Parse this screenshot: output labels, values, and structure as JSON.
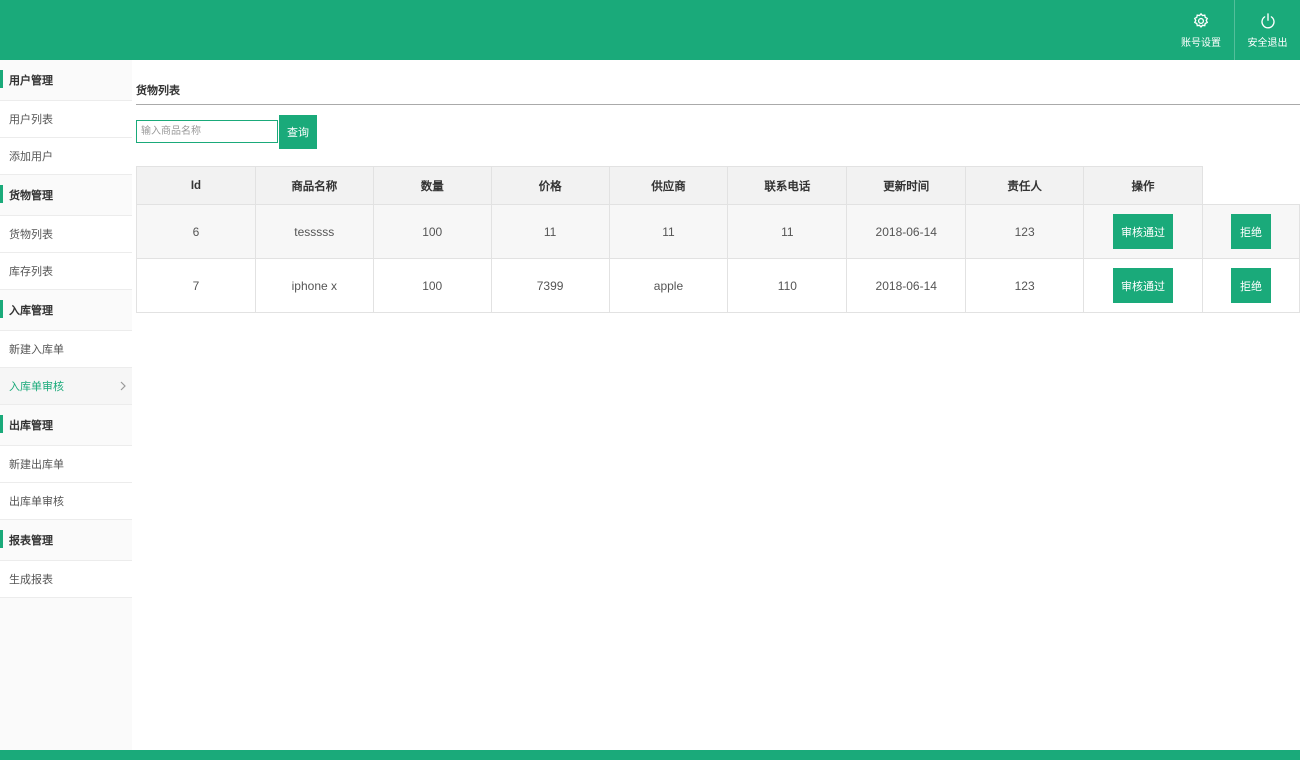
{
  "header": {
    "actions": [
      {
        "label": "账号设置",
        "icon": "gear-icon"
      },
      {
        "label": "安全退出",
        "icon": "power-icon"
      }
    ]
  },
  "sidebar": {
    "groups": [
      {
        "title": "用户管理",
        "items": [
          "用户列表",
          "添加用户"
        ]
      },
      {
        "title": "货物管理",
        "items": [
          "货物列表",
          "库存列表"
        ]
      },
      {
        "title": "入库管理",
        "items": [
          "新建入库单",
          "入库单审核"
        ]
      },
      {
        "title": "出库管理",
        "items": [
          "新建出库单",
          "出库单审核"
        ]
      },
      {
        "title": "报表管理",
        "items": [
          "生成报表"
        ]
      }
    ],
    "active_item": "入库单审核"
  },
  "main": {
    "title": "货物列表",
    "search": {
      "placeholder": "输入商品名称",
      "value": "",
      "button_label": "查询"
    },
    "table": {
      "headers": [
        "Id",
        "商品名称",
        "数量",
        "价格",
        "供应商",
        "联系电话",
        "更新时间",
        "责任人",
        "操作"
      ],
      "rows": [
        [
          "6",
          "tesssss",
          "100",
          "11",
          "11",
          "11",
          "2018-06-14",
          "123"
        ],
        [
          "7",
          "iphone x",
          "100",
          "7399",
          "apple",
          "110",
          "2018-06-14",
          "123"
        ]
      ],
      "approve_label": "审核通过",
      "reject_label": "拒绝"
    }
  },
  "colors": {
    "accent": "#1aaa7a"
  }
}
